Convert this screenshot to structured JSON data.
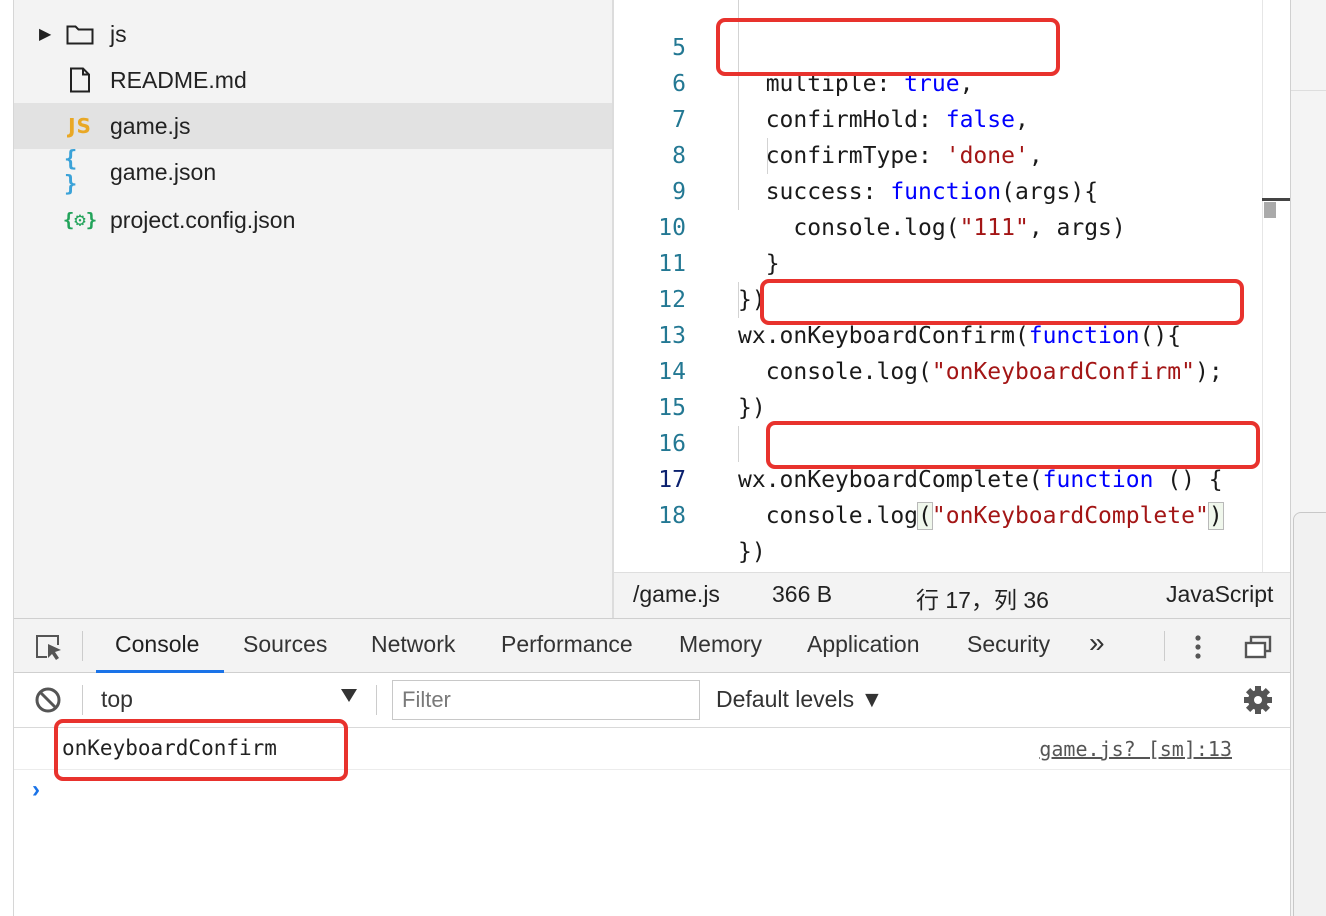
{
  "explorer": {
    "items": [
      {
        "name": "js",
        "icon": "folder-icon",
        "expandable": true
      },
      {
        "name": "README.md",
        "icon": "file-icon"
      },
      {
        "name": "game.js",
        "icon": "js-file-icon",
        "badge": "JS",
        "active": true
      },
      {
        "name": "game.json",
        "icon": "json-file-icon",
        "badge": "{ }"
      },
      {
        "name": "project.config.json",
        "icon": "config-file-icon",
        "badge": "{⚙}"
      }
    ]
  },
  "editor": {
    "lines": [
      {
        "num": "5",
        "text": "  multiple: true,"
      },
      {
        "num": "6",
        "text": "  confirmHold: false,"
      },
      {
        "num": "7",
        "text": "  confirmType: 'done',"
      },
      {
        "num": "8",
        "text": "  success: function(args){"
      },
      {
        "num": "9",
        "text": "    console.log(\"111\", args)"
      },
      {
        "num": "10",
        "text": "  }"
      },
      {
        "num": "11",
        "text": "})"
      },
      {
        "num": "12",
        "text": "wx.onKeyboardConfirm(function(){"
      },
      {
        "num": "13",
        "text": "  console.log(\"onKeyboardConfirm\");"
      },
      {
        "num": "14",
        "text": "})"
      },
      {
        "num": "15",
        "text": ""
      },
      {
        "num": "16",
        "text": "wx.onKeyboardComplete(function () {"
      },
      {
        "num": "17",
        "text": "  console.log(\"onKeyboardComplete\")"
      },
      {
        "num": "18",
        "text": "})"
      }
    ],
    "current_line": "17"
  },
  "statusbar": {
    "path": "/game.js",
    "size": "366 B",
    "position": "行 17，列 36",
    "language": "JavaScript"
  },
  "devtools": {
    "tabs": [
      "Console",
      "Sources",
      "Network",
      "Performance",
      "Memory",
      "Application",
      "Security"
    ],
    "active_tab": "Console",
    "more_label": "»",
    "context": "top",
    "filter_placeholder": "Filter",
    "levels": "Default levels ▼"
  },
  "console": {
    "messages": [
      {
        "text": "onKeyboardConfirm",
        "source": "game.js? [sm]:13"
      }
    ],
    "prompt": "›"
  },
  "colors": {
    "keyword": "#0000ff",
    "string": "#a31515",
    "line_number": "#237893",
    "annotation": "#e8322d",
    "tab_accent": "#1a73e8"
  }
}
